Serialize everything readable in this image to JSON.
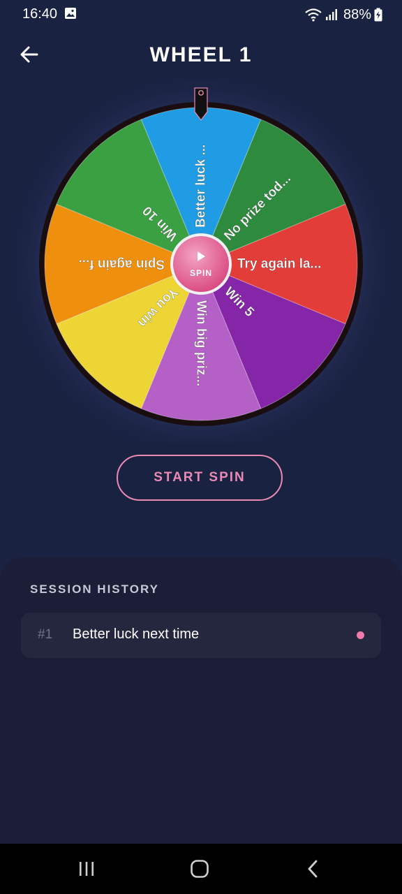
{
  "status_bar": {
    "time": "16:40",
    "battery": "88%"
  },
  "header": {
    "title": "WHEEL 1"
  },
  "wheel": {
    "center_label": "SPIN",
    "segments": [
      {
        "label": "Better luck ...",
        "color": "#1f9ce3"
      },
      {
        "label": "No prize tod...",
        "color": "#2e8b3d"
      },
      {
        "label": "Try again la...",
        "color": "#e23d39"
      },
      {
        "label": "Win 5",
        "color": "#8426a7"
      },
      {
        "label": "Win big priz...",
        "color": "#b560c7"
      },
      {
        "label": "You win",
        "color": "#ecd535"
      },
      {
        "label": "Spin again f...",
        "color": "#ef8f0e"
      },
      {
        "label": "Win 10",
        "color": "#3ba042"
      }
    ]
  },
  "actions": {
    "start_spin": "START SPIN"
  },
  "history": {
    "title": "SESSION HISTORY",
    "items": [
      {
        "index": "#1",
        "text": "Better luck next time",
        "dot_color": "#f07aaa"
      }
    ]
  }
}
